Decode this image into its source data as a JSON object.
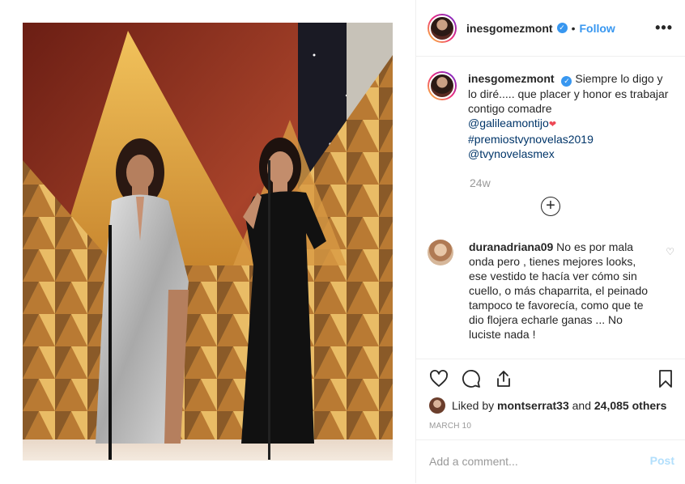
{
  "author": {
    "username": "inesgomezmont",
    "follow_label": "Follow",
    "separator": "•",
    "more_label": "•••"
  },
  "caption": {
    "username": "inesgomezmont",
    "text": "Siempre lo digo y lo diré..... que placer y honor es trabajar contigo comadre",
    "mention_1": "@galileamontijo",
    "hashtag": "#premiostvynovelas2019",
    "mention_2": "@tvynovelasmex",
    "age": "24w"
  },
  "load_more_label": "+",
  "comments": [
    {
      "username": "duranadriana09",
      "text": "No es por mala onda pero , tienes mejores looks, ese vestido te hacía ver cómo sin cuello, o más chaparrita, el peinado tampoco te favorecía, como que te dio flojera echarle ganas ... No luciste nada !"
    }
  ],
  "likes": {
    "prefix": "Liked by",
    "user": "montserrat33",
    "joiner": "and",
    "others": "24,085 others"
  },
  "date": "MARCH 10",
  "add_comment": {
    "placeholder": "Add a comment...",
    "post_label": "Post"
  },
  "icons": [
    "heart-icon",
    "comment-icon",
    "share-icon",
    "bookmark-icon",
    "verified-badge-icon",
    "plus-circle-icon"
  ],
  "colors": {
    "link": "#3897f0",
    "hashtag": "#003569",
    "muted": "#999999",
    "post_disabled": "#b2dffc"
  }
}
